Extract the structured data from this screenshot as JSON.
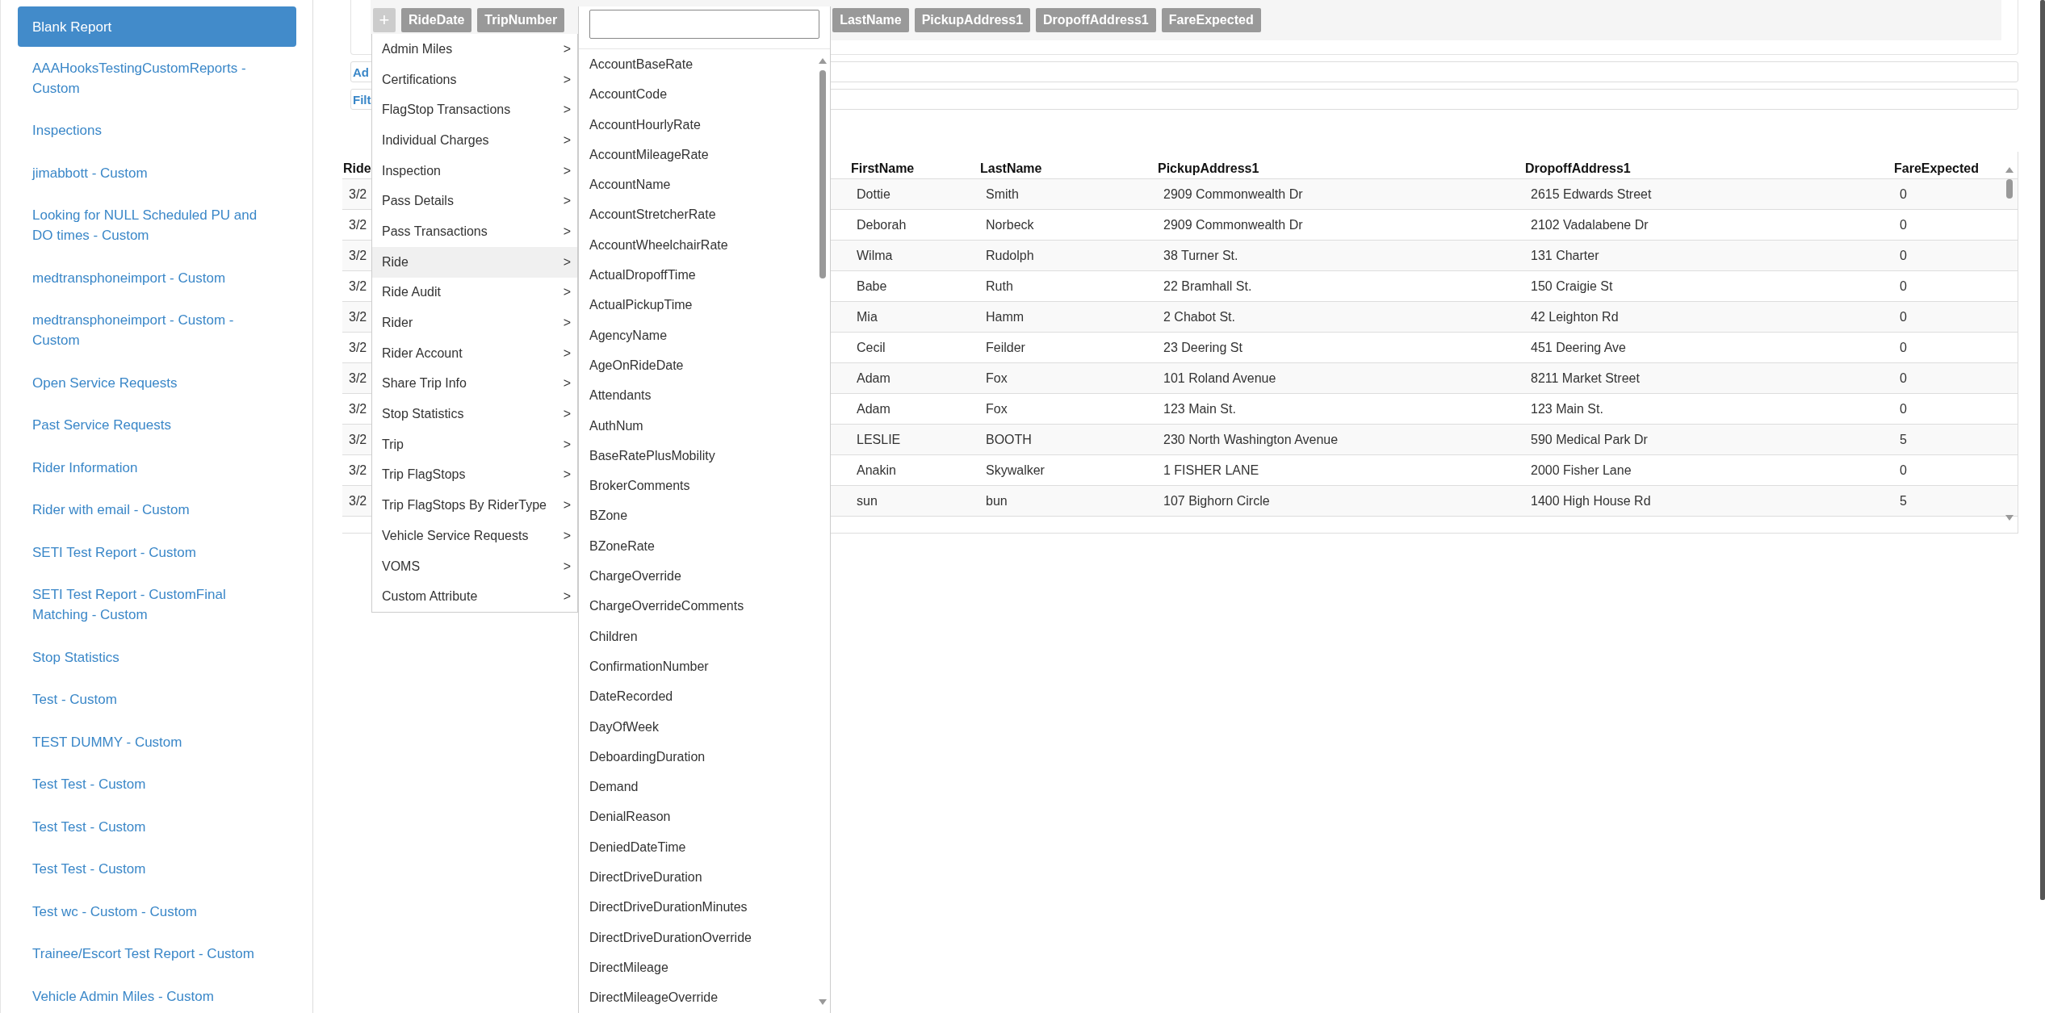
{
  "sidebar": {
    "items": [
      {
        "label": "Blank Report",
        "selected": true
      },
      {
        "label": "AAAHooksTestingCustomReports - Custom",
        "selected": false
      },
      {
        "label": "Inspections",
        "selected": false
      },
      {
        "label": "jimabbott - Custom",
        "selected": false
      },
      {
        "label": "Looking for NULL Scheduled PU and DO times - Custom",
        "selected": false
      },
      {
        "label": "medtransphoneimport - Custom",
        "selected": false
      },
      {
        "label": "medtransphoneimport - Custom - Custom",
        "selected": false
      },
      {
        "label": "Open Service Requests",
        "selected": false
      },
      {
        "label": "Past Service Requests",
        "selected": false
      },
      {
        "label": "Rider Information",
        "selected": false
      },
      {
        "label": "Rider with email - Custom",
        "selected": false
      },
      {
        "label": "SETI Test Report - Custom",
        "selected": false
      },
      {
        "label": "SETI Test Report - CustomFinal Matching - Custom",
        "selected": false
      },
      {
        "label": "Stop Statistics",
        "selected": false
      },
      {
        "label": "Test - Custom",
        "selected": false
      },
      {
        "label": "TEST DUMMY - Custom",
        "selected": false
      },
      {
        "label": "Test Test - Custom",
        "selected": false
      },
      {
        "label": "Test Test - Custom",
        "selected": false
      },
      {
        "label": "Test Test - Custom",
        "selected": false
      },
      {
        "label": "Test wc - Custom - Custom",
        "selected": false
      },
      {
        "label": "Trainee/Escort Test Report - Custom",
        "selected": false
      },
      {
        "label": "Vehicle Admin Miles - Custom",
        "selected": false
      }
    ]
  },
  "column_bar": {
    "add_button": "+",
    "chips": [
      "RideDate",
      "TripNumber",
      "LastName",
      "PickupAddress1",
      "DropoffAddress1",
      "FareExpected"
    ]
  },
  "sections": [
    "Ad",
    "Filt"
  ],
  "table": {
    "columns": [
      "Ride",
      "FirstName",
      "LastName",
      "PickupAddress1",
      "DropoffAddress1",
      "FareExpected"
    ],
    "rows": [
      [
        "3/2",
        "Dottie",
        "Smith",
        "2909 Commonwealth Dr",
        "2615 Edwards Street",
        "0"
      ],
      [
        "3/2",
        "Deborah",
        "Norbeck",
        "2909 Commonwealth Dr",
        "2102 Vadalabene Dr",
        "0"
      ],
      [
        "3/2",
        "Wilma",
        "Rudolph",
        "38 Turner St.",
        "131 Charter",
        "0"
      ],
      [
        "3/2",
        "Babe",
        "Ruth",
        "22 Bramhall St.",
        "150 Craigie St",
        "0"
      ],
      [
        "3/2",
        "Mia",
        "Hamm",
        "2 Chabot St.",
        "42 Leighton Rd",
        "0"
      ],
      [
        "3/2",
        "Cecil",
        "Feilder",
        "23 Deering St",
        "451 Deering Ave",
        "0"
      ],
      [
        "3/2",
        "Adam",
        "Fox",
        "101 Roland Avenue",
        "8211 Market Street",
        "0"
      ],
      [
        "3/2",
        "Adam",
        "Fox",
        "123 Main St.",
        "123 Main St.",
        "0"
      ],
      [
        "3/2",
        "LESLIE",
        "BOOTH",
        "230 North Washington Avenue",
        "590 Medical Park Dr",
        "5"
      ],
      [
        "3/2",
        "Anakin",
        "Skywalker",
        "1 FISHER LANE",
        "2000 Fisher Lane",
        "0"
      ],
      [
        "3/2",
        "sun",
        "bun",
        "107 Bighorn Circle",
        "1400 High House Rd",
        "5"
      ]
    ]
  },
  "category_menu": {
    "items": [
      {
        "label": "Admin Miles",
        "arrow": ">",
        "selected": false
      },
      {
        "label": "Certifications",
        "arrow": ">",
        "selected": false
      },
      {
        "label": "FlagStop Transactions",
        "arrow": ">",
        "selected": false
      },
      {
        "label": "Individual Charges",
        "arrow": ">",
        "selected": false
      },
      {
        "label": "Inspection",
        "arrow": ">",
        "selected": false
      },
      {
        "label": "Pass Details",
        "arrow": ">",
        "selected": false
      },
      {
        "label": "Pass Transactions",
        "arrow": ">",
        "selected": false
      },
      {
        "label": "Ride",
        "arrow": ">",
        "selected": true
      },
      {
        "label": "Ride Audit",
        "arrow": ">",
        "selected": false
      },
      {
        "label": "Rider",
        "arrow": ">",
        "selected": false
      },
      {
        "label": "Rider Account",
        "arrow": ">",
        "selected": false
      },
      {
        "label": "Share Trip Info",
        "arrow": ">",
        "selected": false
      },
      {
        "label": "Stop Statistics",
        "arrow": ">",
        "selected": false
      },
      {
        "label": "Trip",
        "arrow": ">",
        "selected": false
      },
      {
        "label": "Trip FlagStops",
        "arrow": ">",
        "selected": false
      },
      {
        "label": "Trip FlagStops By RiderType",
        "arrow": ">",
        "selected": false
      },
      {
        "label": "Vehicle Service Requests",
        "arrow": ">",
        "selected": false
      },
      {
        "label": "VOMS",
        "arrow": ">",
        "selected": false
      },
      {
        "label": "Custom Attribute",
        "arrow": ">",
        "selected": false
      }
    ]
  },
  "field_list": {
    "items": [
      "AccountBaseRate",
      "AccountCode",
      "AccountHourlyRate",
      "AccountMileageRate",
      "AccountName",
      "AccountStretcherRate",
      "AccountWheelchairRate",
      "ActualDropoffTime",
      "ActualPickupTime",
      "AgencyName",
      "AgeOnRideDate",
      "Attendants",
      "AuthNum",
      "BaseRatePlusMobility",
      "BrokerComments",
      "BZone",
      "BZoneRate",
      "ChargeOverride",
      "ChargeOverrideComments",
      "Children",
      "ConfirmationNumber",
      "DateRecorded",
      "DayOfWeek",
      "DeboardingDuration",
      "Demand",
      "DenialReason",
      "DeniedDateTime",
      "DirectDriveDuration",
      "DirectDriveDurationMinutes",
      "DirectDriveDurationOverride",
      "DirectMileage",
      "DirectMileageOverride"
    ]
  }
}
